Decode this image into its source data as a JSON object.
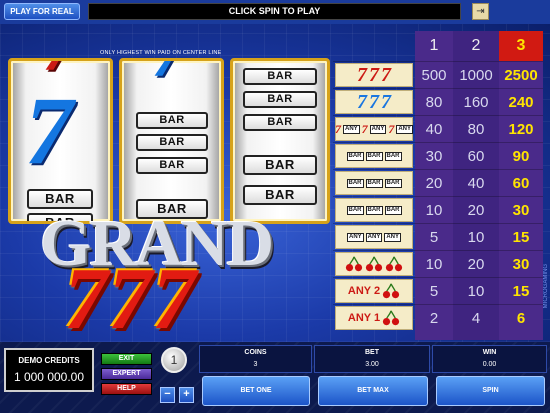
{
  "topbar": {
    "play_for_real": "PLAY FOR REAL",
    "message": "CLICK SPIN TO PLAY",
    "exit_icon": "exit-door-icon"
  },
  "game": {
    "note": "ONLY HIGHEST WIN PAID ON CENTER LINE",
    "logo_word": "GRAND",
    "logo_number": "777",
    "side_brand": "MICROGAMING",
    "reels": [
      {
        "symbols": [
          "red-seven (partial)",
          "blue-seven",
          "BAR",
          "BAR (partial)"
        ]
      },
      {
        "symbols": [
          "blue-seven (partial)",
          "BAR",
          "BAR",
          "BAR",
          "BAR"
        ]
      },
      {
        "symbols": [
          "BAR",
          "BAR",
          "BAR",
          "BAR",
          "BAR"
        ]
      }
    ],
    "bar_label": "BAR",
    "seven_label": "7"
  },
  "paytable": {
    "headers": [
      "1",
      "2",
      "3"
    ],
    "active_column": 2,
    "rows": [
      {
        "symbol": "three-red-sevens",
        "payouts": [
          "500",
          "1000",
          "2500"
        ]
      },
      {
        "symbol": "three-blue-sevens",
        "payouts": [
          "80",
          "160",
          "240"
        ]
      },
      {
        "symbol": "any-three-sevens",
        "label": "ANY",
        "payouts": [
          "40",
          "80",
          "120"
        ]
      },
      {
        "symbol": "three-triple-bars",
        "payouts": [
          "30",
          "60",
          "90"
        ]
      },
      {
        "symbol": "three-double-bars",
        "payouts": [
          "20",
          "40",
          "60"
        ]
      },
      {
        "symbol": "three-single-bars",
        "payouts": [
          "10",
          "20",
          "30"
        ]
      },
      {
        "symbol": "any-three-bars",
        "label": "ANY",
        "payouts": [
          "5",
          "10",
          "15"
        ]
      },
      {
        "symbol": "three-cherries",
        "payouts": [
          "10",
          "20",
          "30"
        ]
      },
      {
        "symbol": "any-two-cherries",
        "label": "ANY 2",
        "payouts": [
          "5",
          "10",
          "15"
        ]
      },
      {
        "symbol": "any-one-cherry",
        "label": "ANY 1",
        "payouts": [
          "2",
          "4",
          "6"
        ]
      }
    ]
  },
  "bottom": {
    "credits_label": "DEMO CREDITS",
    "credits_value": "1 000 000.00",
    "exit_label": "EXIT",
    "expert_label": "EXPERT",
    "help_label": "HELP",
    "coin_value": "1",
    "minus_label": "−",
    "plus_label": "+",
    "coins_label": "COINS",
    "coins_value": "3",
    "bet_label": "BET",
    "bet_value": "3.00",
    "win_label": "WIN",
    "win_value": "0.00",
    "bet_one_label": "BET ONE",
    "bet_max_label": "BET MAX",
    "spin_label": "SPIN"
  },
  "colors": {
    "background": "#1b3aa8",
    "reel_frame": "#d6a21a",
    "active_column": "#d11a12",
    "active_text": "#ffe400",
    "paytable_column": "#4a2a8a",
    "button_blue": "#1c54c8"
  }
}
